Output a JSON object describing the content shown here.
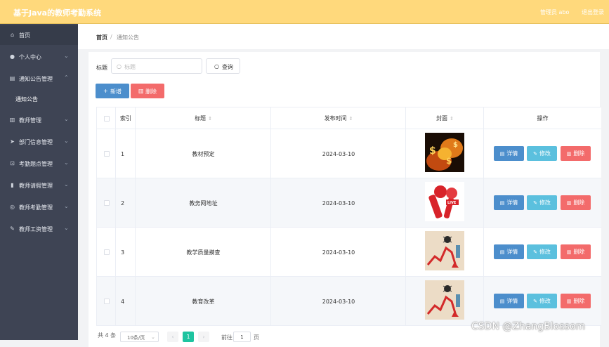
{
  "header": {
    "title": "基于Java的教师考勤系统",
    "admin": "管理员 abo",
    "logout": "退出登录"
  },
  "sidebar": {
    "items": [
      {
        "label": "首页",
        "icon": "home-icon",
        "glyph": "⌂",
        "arrow": ""
      },
      {
        "label": "个人中心",
        "icon": "user-icon",
        "glyph": "●",
        "arrow": "⌄"
      },
      {
        "label": "通知公告管理",
        "icon": "notice-icon",
        "glyph": "▤",
        "arrow": "⌃"
      },
      {
        "label": "教师管理",
        "icon": "teacher-icon",
        "glyph": "▥",
        "arrow": "⌄"
      },
      {
        "label": "部门信息管理",
        "icon": "send-icon",
        "glyph": "➤",
        "arrow": "⌄"
      },
      {
        "label": "考勤题点管理",
        "icon": "crop-icon",
        "glyph": "⊡",
        "arrow": "⌄"
      },
      {
        "label": "教师请假管理",
        "icon": "chart-icon",
        "glyph": "▮",
        "arrow": "⌄"
      },
      {
        "label": "教师考勤管理",
        "icon": "globe-icon",
        "glyph": "◎",
        "arrow": "⌄"
      },
      {
        "label": "教师工资管理",
        "icon": "pen-icon",
        "glyph": "✎",
        "arrow": "⌄"
      }
    ],
    "submenu": "通知公告"
  },
  "breadcrumb": {
    "home": "首页",
    "sep": "/",
    "current": "通知公告"
  },
  "filter": {
    "label": "标题",
    "placeholder": "标题",
    "query": "查询"
  },
  "actions": {
    "add": "新增",
    "delete": "删除"
  },
  "table": {
    "headers": {
      "index": "索引",
      "title": "标题",
      "date": "发布时间",
      "cover": "封面",
      "ops": "操作"
    },
    "rows": [
      {
        "index": "1",
        "title": "教材预定",
        "date": "2024-03-10",
        "cover": "dollar-fire"
      },
      {
        "index": "2",
        "title": "教务网地址",
        "date": "2024-03-10",
        "cover": "live-mic"
      },
      {
        "index": "3",
        "title": "教学质量摸查",
        "date": "2024-03-10",
        "cover": "crash-chart"
      },
      {
        "index": "4",
        "title": "教育改革",
        "date": "2024-03-10",
        "cover": "crash-chart"
      }
    ],
    "btn": {
      "detail": "详情",
      "edit": "修改",
      "delete": "删除"
    }
  },
  "pagination": {
    "total": "共 4 条",
    "size": "10条/页",
    "prev": "‹",
    "current": "1",
    "next": "›",
    "goto": "前往",
    "goto_value": "1",
    "page": "页"
  },
  "watermark": "CSDN @ZhangBlossom",
  "colors": {
    "header": "#ffd97c",
    "sidebar": "#3e4454",
    "primary": "#4c8ecc",
    "info": "#5bc0de",
    "danger": "#f36b6b",
    "pager_active": "#1ec4a0"
  }
}
